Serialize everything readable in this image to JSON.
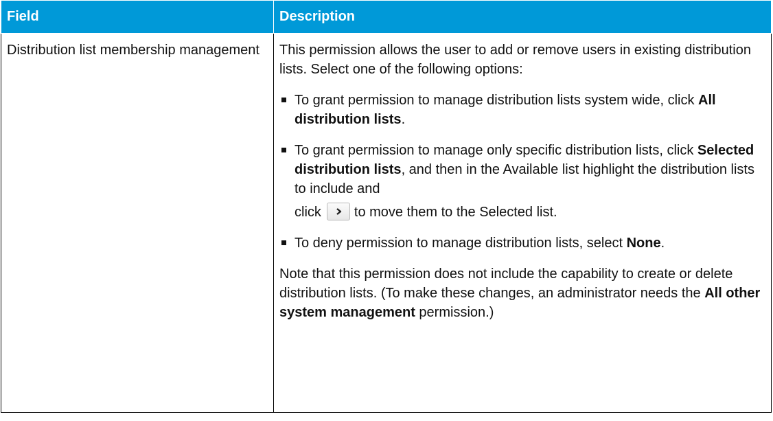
{
  "table": {
    "headers": [
      "Field",
      "Description"
    ],
    "row": {
      "field": "Distribution list membership management",
      "intro": "This permission allows the user to add or remove users in existing distribution lists. Select one of the following options:",
      "bullets": [
        {
          "pre": "To grant permission to manage distribution lists system wide, click ",
          "bold": "All distribution lists",
          "post": "."
        },
        {
          "pre": "To grant permission to manage only specific distribution lists, click ",
          "bold": "Selected distribution lists",
          "post": ", and then in the Available list highlight the distribution lists to include and",
          "click_word": "click",
          "after_button": "to move them to the Selected list."
        },
        {
          "pre": "To deny permission to manage distribution lists, select ",
          "bold": "None",
          "post": "."
        }
      ],
      "note_pre": "Note that this permission does not include the capability to create or delete distribution lists. (To make these changes, an administrator needs the ",
      "note_bold": "All other system management",
      "note_post": " permission.)"
    }
  },
  "icons": {
    "move_button": "chevron-right-icon"
  },
  "colors": {
    "header_bg": "#0099d8",
    "header_text": "#ffffff"
  }
}
